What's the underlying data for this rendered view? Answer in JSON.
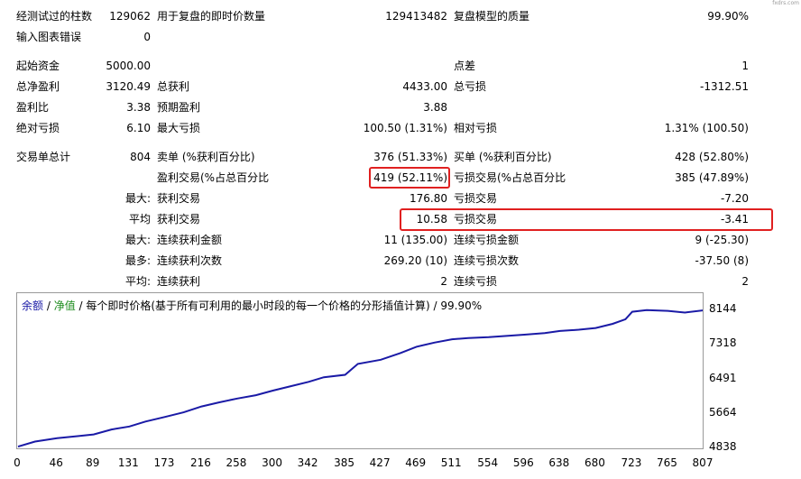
{
  "watermark": "fxdrs.com",
  "stats": {
    "row1": {
      "c1_label": "经测试过的柱数",
      "c1_value": "129062",
      "c2_label": "用于复盘的即时价数量",
      "c2_value": "129413482",
      "c3_label": "复盘模型的质量",
      "c3_value": "99.90%"
    },
    "row2": {
      "label": "输入图表错误",
      "value": "0"
    },
    "row3": {
      "c1_label": "起始资金",
      "c1_value": "5000.00",
      "c3_label": "点差",
      "c3_value": "1"
    },
    "row4": {
      "c1_label": "总净盈利",
      "c1_value": "3120.49",
      "c2_label": "总获利",
      "c2_value": "4433.00",
      "c3_label": "总亏损",
      "c3_value": "-1312.51"
    },
    "row5": {
      "c1_label": "盈利比",
      "c1_value": "3.38",
      "c2_label": "预期盈利",
      "c2_value": "3.88"
    },
    "row6": {
      "c1_label": "绝对亏损",
      "c1_value": "6.10",
      "c2_label": "最大亏损",
      "c2_value": "100.50 (1.31%)",
      "c3_label": "相对亏损",
      "c3_value": "1.31% (100.50)"
    },
    "row7": {
      "c1_label": "交易单总计",
      "c1_value": "804",
      "c2_label": "卖单 (%获利百分比)",
      "c2_value": "376 (51.33%)",
      "c3_label": "买单 (%获利百分比)",
      "c3_value": "428 (52.80%)"
    },
    "row8": {
      "c2_label": "盈利交易(%占总百分比",
      "c2_value": "419 (52.11%)",
      "c3_label": "亏损交易(%占总百分比",
      "c3_value": "385 (47.89%)"
    },
    "row9": {
      "prefix": "最大:",
      "c2_label": "获利交易",
      "c2_value": "176.80",
      "c3_label": "亏损交易",
      "c3_value": "-7.20"
    },
    "row10": {
      "prefix": "平均",
      "c2_label": "获利交易",
      "c2_value": "10.58",
      "c3_label": "亏损交易",
      "c3_value": "-3.41"
    },
    "row11": {
      "prefix": "最大:",
      "c2_label": "连续获利金额",
      "c2_value": "11 (135.00)",
      "c3_label": "连续亏损金额",
      "c3_value": "9 (-25.30)"
    },
    "row12": {
      "prefix": "最多:",
      "c2_label": "连续获利次数",
      "c2_value": "269.20 (10)",
      "c3_label": "连续亏损次数",
      "c3_value": "-37.50 (8)"
    },
    "row13": {
      "prefix": "平均:",
      "c2_label": "连续获利",
      "c2_value": "2",
      "c3_label": "连续亏损",
      "c3_value": "2"
    }
  },
  "legend": {
    "balance": "余额",
    "sep1": " / ",
    "equity": "净值",
    "sep2": " / ",
    "description": "每个即时价格(基于所有可利用的最小时段的每一个价格的分形插值计算) / 99.90%"
  },
  "colors": {
    "balance_line": "#1a1aa6",
    "equity_line": "#1a8a1a",
    "highlight": "#e02020"
  },
  "chart_data": {
    "type": "line",
    "series": [
      {
        "name": "余额",
        "x": [
          0,
          20,
          46,
          70,
          89,
          110,
          131,
          150,
          173,
          195,
          216,
          237,
          258,
          280,
          300,
          320,
          342,
          360,
          385,
          400,
          427,
          450,
          469,
          490,
          511,
          530,
          554,
          575,
          596,
          620,
          638,
          660,
          680,
          700,
          715,
          723,
          740,
          765,
          785,
          807
        ],
        "values": [
          4880,
          5000,
          5080,
          5130,
          5170,
          5290,
          5360,
          5480,
          5590,
          5700,
          5840,
          5940,
          6030,
          6110,
          6220,
          6320,
          6430,
          6540,
          6600,
          6860,
          6960,
          7120,
          7270,
          7370,
          7450,
          7480,
          7500,
          7530,
          7560,
          7600,
          7650,
          7680,
          7720,
          7820,
          7930,
          8110,
          8150,
          8130,
          8090,
          8144
        ]
      }
    ],
    "xticks": [
      0,
      46,
      89,
      131,
      173,
      216,
      258,
      300,
      342,
      385,
      427,
      469,
      511,
      554,
      596,
      638,
      680,
      723,
      765,
      807
    ],
    "yticks": [
      4838,
      5664,
      6491,
      7318,
      8144
    ],
    "xlim": [
      0,
      807
    ],
    "ylim": [
      4838,
      8144
    ],
    "grid": false
  }
}
